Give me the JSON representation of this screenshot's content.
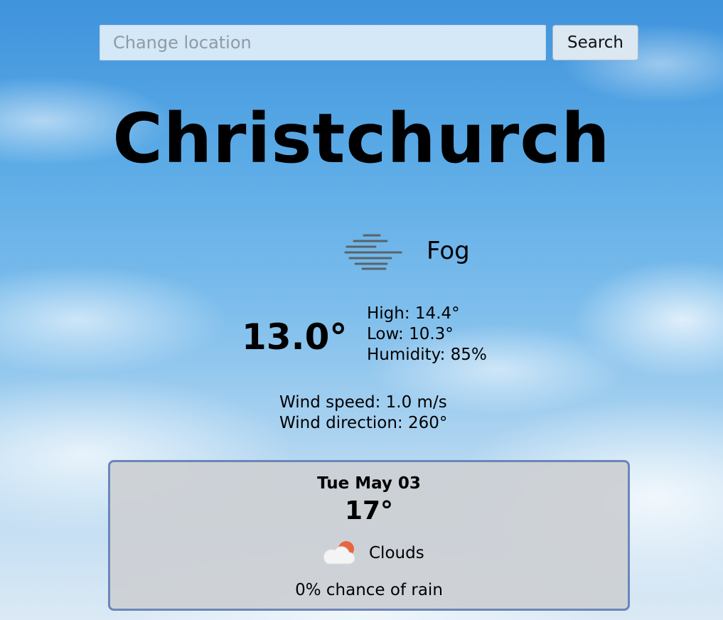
{
  "search": {
    "placeholder": "Change location",
    "value": "",
    "button_label": "Search"
  },
  "location": {
    "city": "Christchurch"
  },
  "current": {
    "condition": "Fog",
    "condition_icon": "fog-icon",
    "temperature": "13.0°",
    "high": "High: 14.4°",
    "low": "Low: 10.3°",
    "humidity": "Humidity: 85%",
    "wind_speed": "Wind speed: 1.0 m/s",
    "wind_direction": "Wind direction: 260°"
  },
  "forecast": [
    {
      "date": "Tue May 03",
      "temperature": "17°",
      "condition": "Clouds",
      "condition_icon": "clouds-icon",
      "rain_chance": "0% chance of rain"
    }
  ],
  "colors": {
    "sky_top": "#3f93dc",
    "sky_bottom": "#dbe9f5",
    "card_border": "#6b86b8",
    "card_background": "#cdd0d4",
    "sun": "#e8653f"
  }
}
